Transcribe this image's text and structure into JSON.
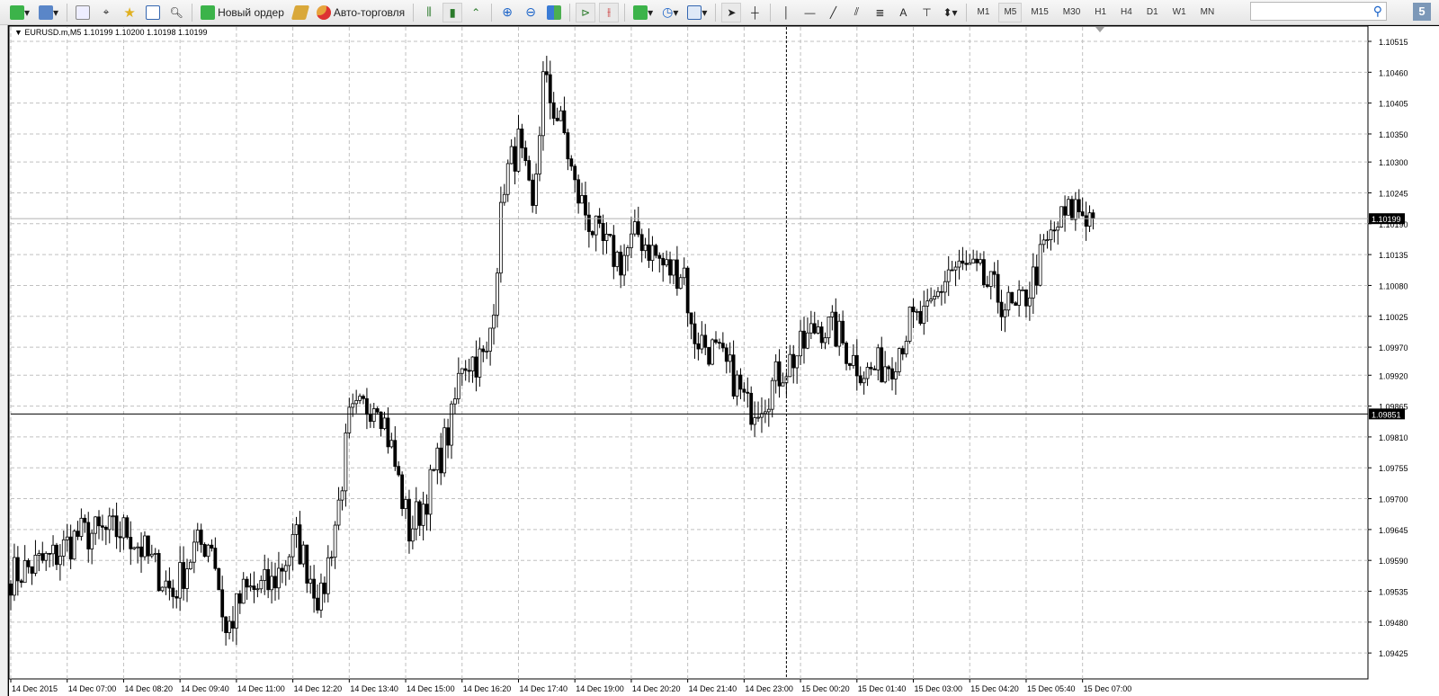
{
  "toolbar": {
    "new_order_label": "Новый ордер",
    "autotrading_label": "Авто-торговля",
    "timeframes": [
      "M1",
      "M5",
      "M15",
      "M30",
      "H1",
      "H4",
      "D1",
      "W1",
      "MN"
    ],
    "active_timeframe": "M5",
    "search_placeholder": "",
    "notifications_count": "5"
  },
  "chart": {
    "symbol_info": "EURUSD.m,M5  1.10199 1.10200 1.10198 1.10199",
    "bid_label": "1.10199",
    "crosshair_price_label": "1.09851"
  },
  "chart_data": {
    "type": "candlestick",
    "symbol": "EURUSD.m",
    "timeframe": "M5",
    "ylim": [
      1.09405,
      1.1054
    ],
    "price_ticks": [
      "1.10515",
      "1.10460",
      "1.10405",
      "1.10350",
      "1.10300",
      "1.10245",
      "1.10190",
      "1.10135",
      "1.10080",
      "1.10025",
      "1.09970",
      "1.09920",
      "1.09865",
      "1.09810",
      "1.09755",
      "1.09700",
      "1.09645",
      "1.09590",
      "1.09535",
      "1.09480",
      "1.09425"
    ],
    "time_ticks": [
      "14 Dec 2015",
      "14 Dec 07:00",
      "14 Dec 08:20",
      "14 Dec 09:40",
      "14 Dec 11:00",
      "14 Dec 12:20",
      "14 Dec 13:40",
      "14 Dec 15:00",
      "14 Dec 16:20",
      "14 Dec 17:40",
      "14 Dec 19:00",
      "14 Dec 20:20",
      "14 Dec 21:40",
      "14 Dec 23:00",
      "15 Dec 00:20",
      "15 Dec 01:40",
      "15 Dec 03:00",
      "15 Dec 04:20",
      "15 Dec 05:40",
      "15 Dec 07:00"
    ],
    "bars_per_time_tick": 16,
    "bar_count": 308,
    "bid": 1.10199,
    "crosshair_price": 1.09851,
    "crosshair_bar": 220,
    "close_path": [
      [
        0,
        1.09563
      ],
      [
        12,
        1.09595
      ],
      [
        19,
        1.09635
      ],
      [
        33,
        1.09643
      ],
      [
        38,
        1.09603
      ],
      [
        46,
        1.09531
      ],
      [
        52,
        1.09611
      ],
      [
        57,
        1.09627
      ],
      [
        61,
        1.09459
      ],
      [
        66,
        1.09531
      ],
      [
        74,
        1.09547
      ],
      [
        81,
        1.09627
      ],
      [
        88,
        1.09515
      ],
      [
        93,
        1.09691
      ],
      [
        96,
        1.09836
      ],
      [
        104,
        1.09884
      ],
      [
        108,
        1.09787
      ],
      [
        113,
        1.09643
      ],
      [
        117,
        1.09691
      ],
      [
        119,
        1.09723
      ],
      [
        125,
        1.09836
      ],
      [
        128,
        1.09948
      ],
      [
        135,
        1.09948
      ],
      [
        137,
        1.1006
      ],
      [
        140,
        1.10268
      ],
      [
        144,
        1.10332
      ],
      [
        148,
        1.10204
      ],
      [
        151,
        1.10445
      ],
      [
        157,
        1.10348
      ],
      [
        160,
        1.10252
      ],
      [
        167,
        1.10156
      ],
      [
        173,
        1.10124
      ],
      [
        178,
        1.10172
      ],
      [
        186,
        1.10108
      ],
      [
        191,
        1.10108
      ],
      [
        193,
        1.09996
      ],
      [
        199,
        1.09964
      ],
      [
        205,
        1.09916
      ],
      [
        209,
        1.0986
      ],
      [
        214,
        1.09884
      ],
      [
        219,
        1.09932
      ],
      [
        224,
        1.09964
      ],
      [
        229,
        1.10012
      ],
      [
        234,
        1.09996
      ],
      [
        239,
        1.09948
      ],
      [
        243,
        1.09924
      ],
      [
        250,
        1.09948
      ],
      [
        255,
        1.10012
      ],
      [
        260,
        1.1002
      ],
      [
        266,
        1.10108
      ],
      [
        271,
        1.10108
      ],
      [
        275,
        1.10092
      ],
      [
        280,
        1.1006
      ],
      [
        285,
        1.10028
      ],
      [
        289,
        1.10076
      ],
      [
        293,
        1.1014
      ],
      [
        297,
        1.10188
      ],
      [
        302,
        1.1022
      ],
      [
        307,
        1.10199
      ]
    ]
  }
}
